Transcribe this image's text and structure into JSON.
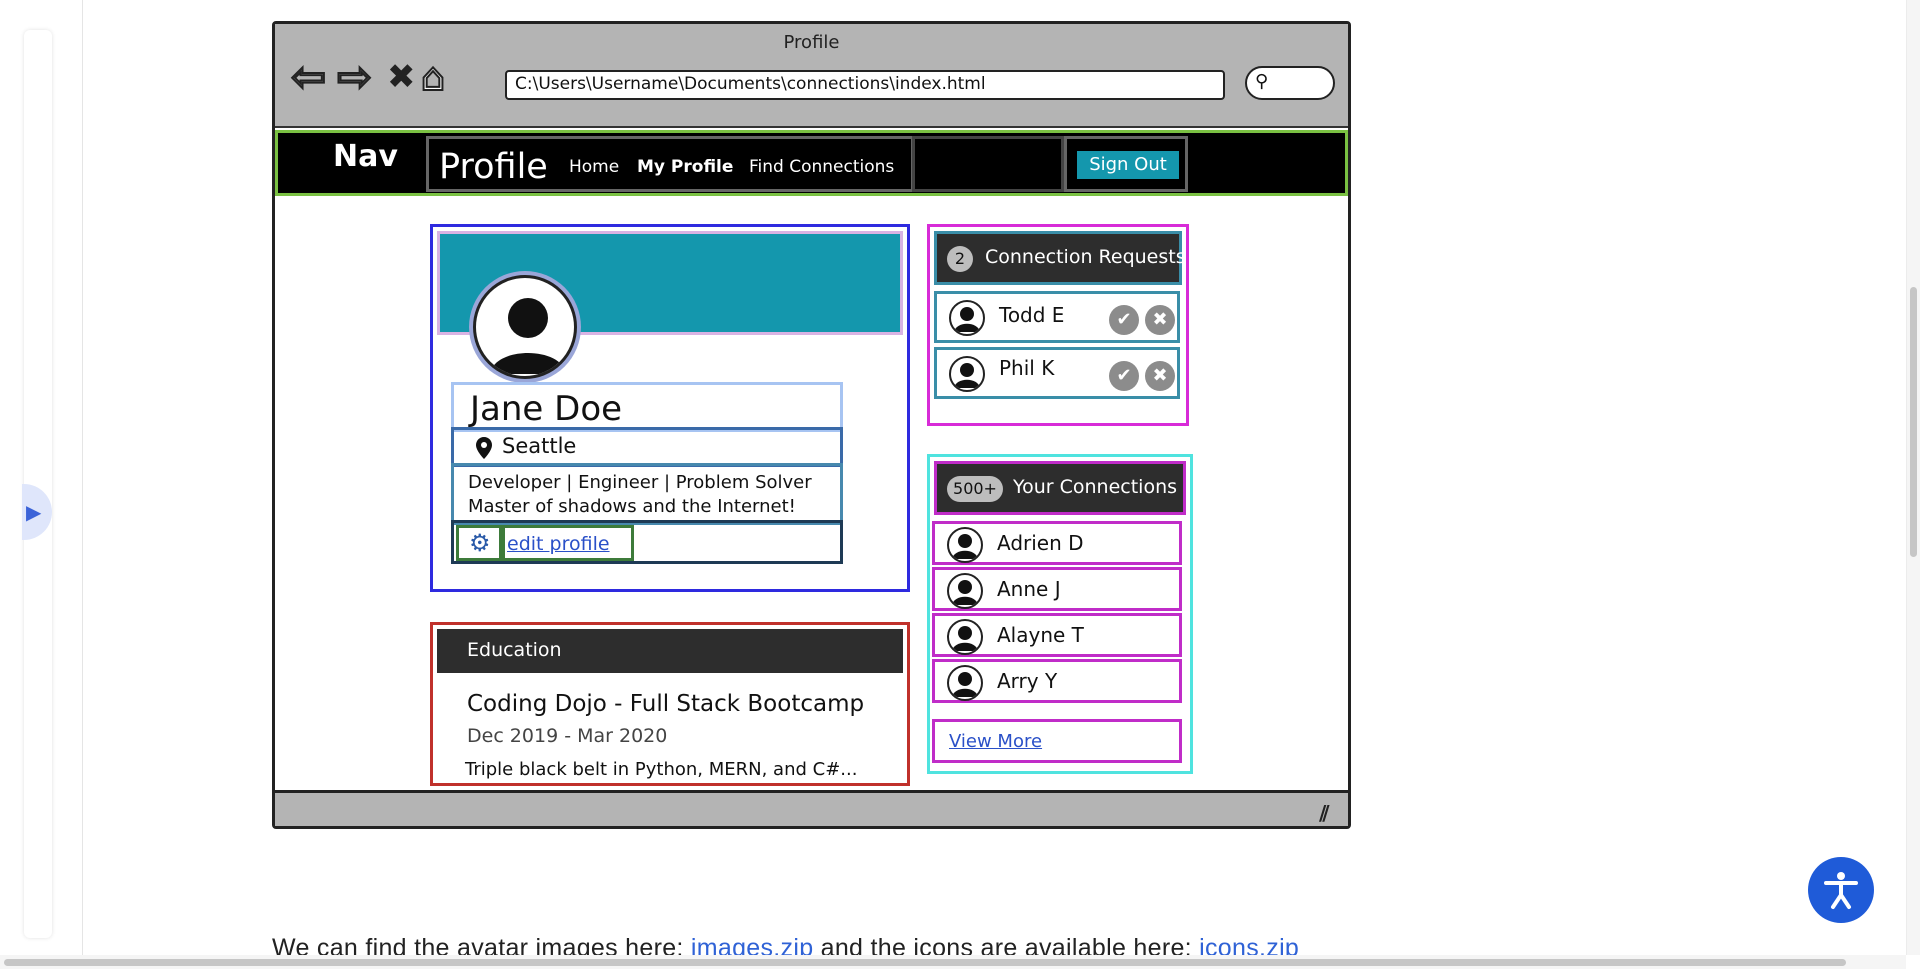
{
  "mockup": {
    "window_title": "Profile",
    "url": "C:\\Users\\Username\\Documents\\connections\\index.html",
    "nav": {
      "nav_word": "Nav",
      "brand": "Profile",
      "links": [
        "Home",
        "My Profile",
        "Find Connections"
      ],
      "sign_out": "Sign Out"
    },
    "profile": {
      "name": "Jane Doe",
      "location": "Seattle",
      "bio_line1": "Developer | Engineer | Problem Solver",
      "bio_line2": "Master of shadows and the Internet!",
      "edit_link": "edit profile"
    },
    "education": {
      "title": "Education",
      "school": "Coding Dojo - Full Stack Bootcamp",
      "dates": "Dec 2019 - Mar 2020",
      "description": "Triple black belt in Python, MERN, and C#..."
    },
    "requests": {
      "count": "2",
      "title": "Connection Requests",
      "people": [
        {
          "name": "Todd E"
        },
        {
          "name": "Phil K"
        }
      ]
    },
    "connections": {
      "count": "500+",
      "title": "Your Connections",
      "people": [
        {
          "name": "Adrien D"
        },
        {
          "name": "Anne J"
        },
        {
          "name": "Alayne T"
        },
        {
          "name": "Arry Y"
        }
      ],
      "view_more": "View More"
    }
  },
  "page_text": {
    "prefix": "We can find the avatar images here: ",
    "images_link": "images.zip",
    "middle": " and the icons are available here: ",
    "icons_link": "icons.zip"
  },
  "colors": {
    "teal": "#1497ad",
    "nav_outline": "#7ac142",
    "profile_outline": "#2e2adf",
    "education_outline": "#c0312b",
    "side_outline": "#d82bd8",
    "accessibility_button": "#1f5bd8"
  }
}
